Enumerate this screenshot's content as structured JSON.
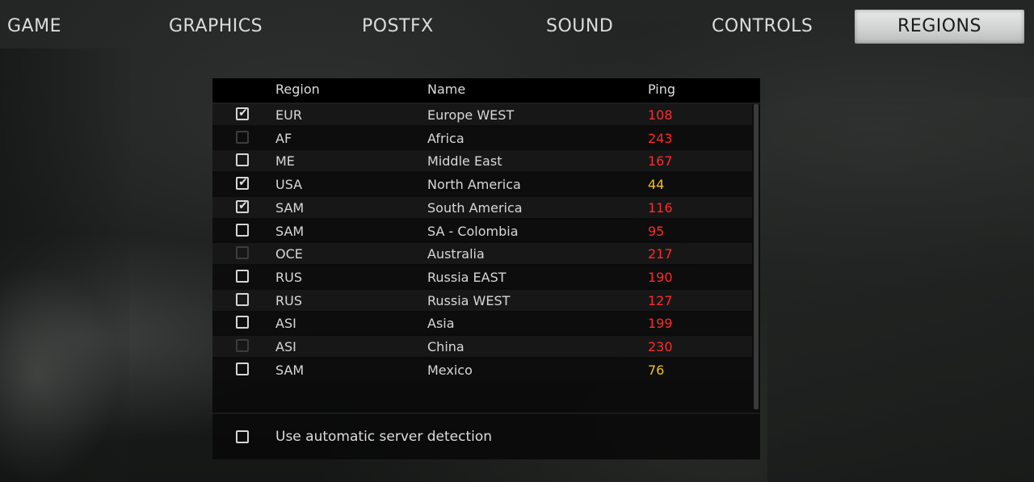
{
  "nav": {
    "tabs": [
      {
        "label": "GAME"
      },
      {
        "label": "GRAPHICS"
      },
      {
        "label": "POSTFX"
      },
      {
        "label": "SOUND"
      },
      {
        "label": "CONTROLS"
      },
      {
        "label": "REGIONS",
        "active": true
      }
    ]
  },
  "table": {
    "headers": {
      "region": "Region",
      "name": "Name",
      "ping": "Ping"
    },
    "rows": [
      {
        "region": "EUR",
        "name": "Europe WEST",
        "ping": "108",
        "checked": true,
        "enabled": true,
        "ping_color": "#ff2a2a"
      },
      {
        "region": "AF",
        "name": "Africa",
        "ping": "243",
        "checked": false,
        "enabled": false,
        "ping_color": "#ff2a2a"
      },
      {
        "region": "ME",
        "name": "Middle East",
        "ping": "167",
        "checked": false,
        "enabled": true,
        "ping_color": "#ff2a2a"
      },
      {
        "region": "USA",
        "name": "North America",
        "ping": "44",
        "checked": true,
        "enabled": true,
        "ping_color": "#f2c21b"
      },
      {
        "region": "SAM",
        "name": "South America",
        "ping": "116",
        "checked": true,
        "enabled": true,
        "ping_color": "#ff2a2a"
      },
      {
        "region": "SAM",
        "name": "SA - Colombia",
        "ping": "95",
        "checked": false,
        "enabled": true,
        "ping_color": "#ff2a2a"
      },
      {
        "region": "OCE",
        "name": "Australia",
        "ping": "217",
        "checked": false,
        "enabled": false,
        "ping_color": "#ff2a2a"
      },
      {
        "region": "RUS",
        "name": "Russia EAST",
        "ping": "190",
        "checked": false,
        "enabled": true,
        "ping_color": "#ff2a2a"
      },
      {
        "region": "RUS",
        "name": "Russia WEST",
        "ping": "127",
        "checked": false,
        "enabled": true,
        "ping_color": "#ff2a2a"
      },
      {
        "region": "ASI",
        "name": "Asia",
        "ping": "199",
        "checked": false,
        "enabled": true,
        "ping_color": "#ff2a2a"
      },
      {
        "region": "ASI",
        "name": "China",
        "ping": "230",
        "checked": false,
        "enabled": false,
        "ping_color": "#ff2a2a"
      },
      {
        "region": "SAM",
        "name": "Mexico",
        "ping": "76",
        "checked": false,
        "enabled": true,
        "ping_color": "#f2c21b"
      }
    ]
  },
  "auto_detect": {
    "label": "Use automatic server detection",
    "checked": false
  },
  "colors": {
    "ping_high": "#ff2a2a",
    "ping_medium": "#f2c21b"
  }
}
